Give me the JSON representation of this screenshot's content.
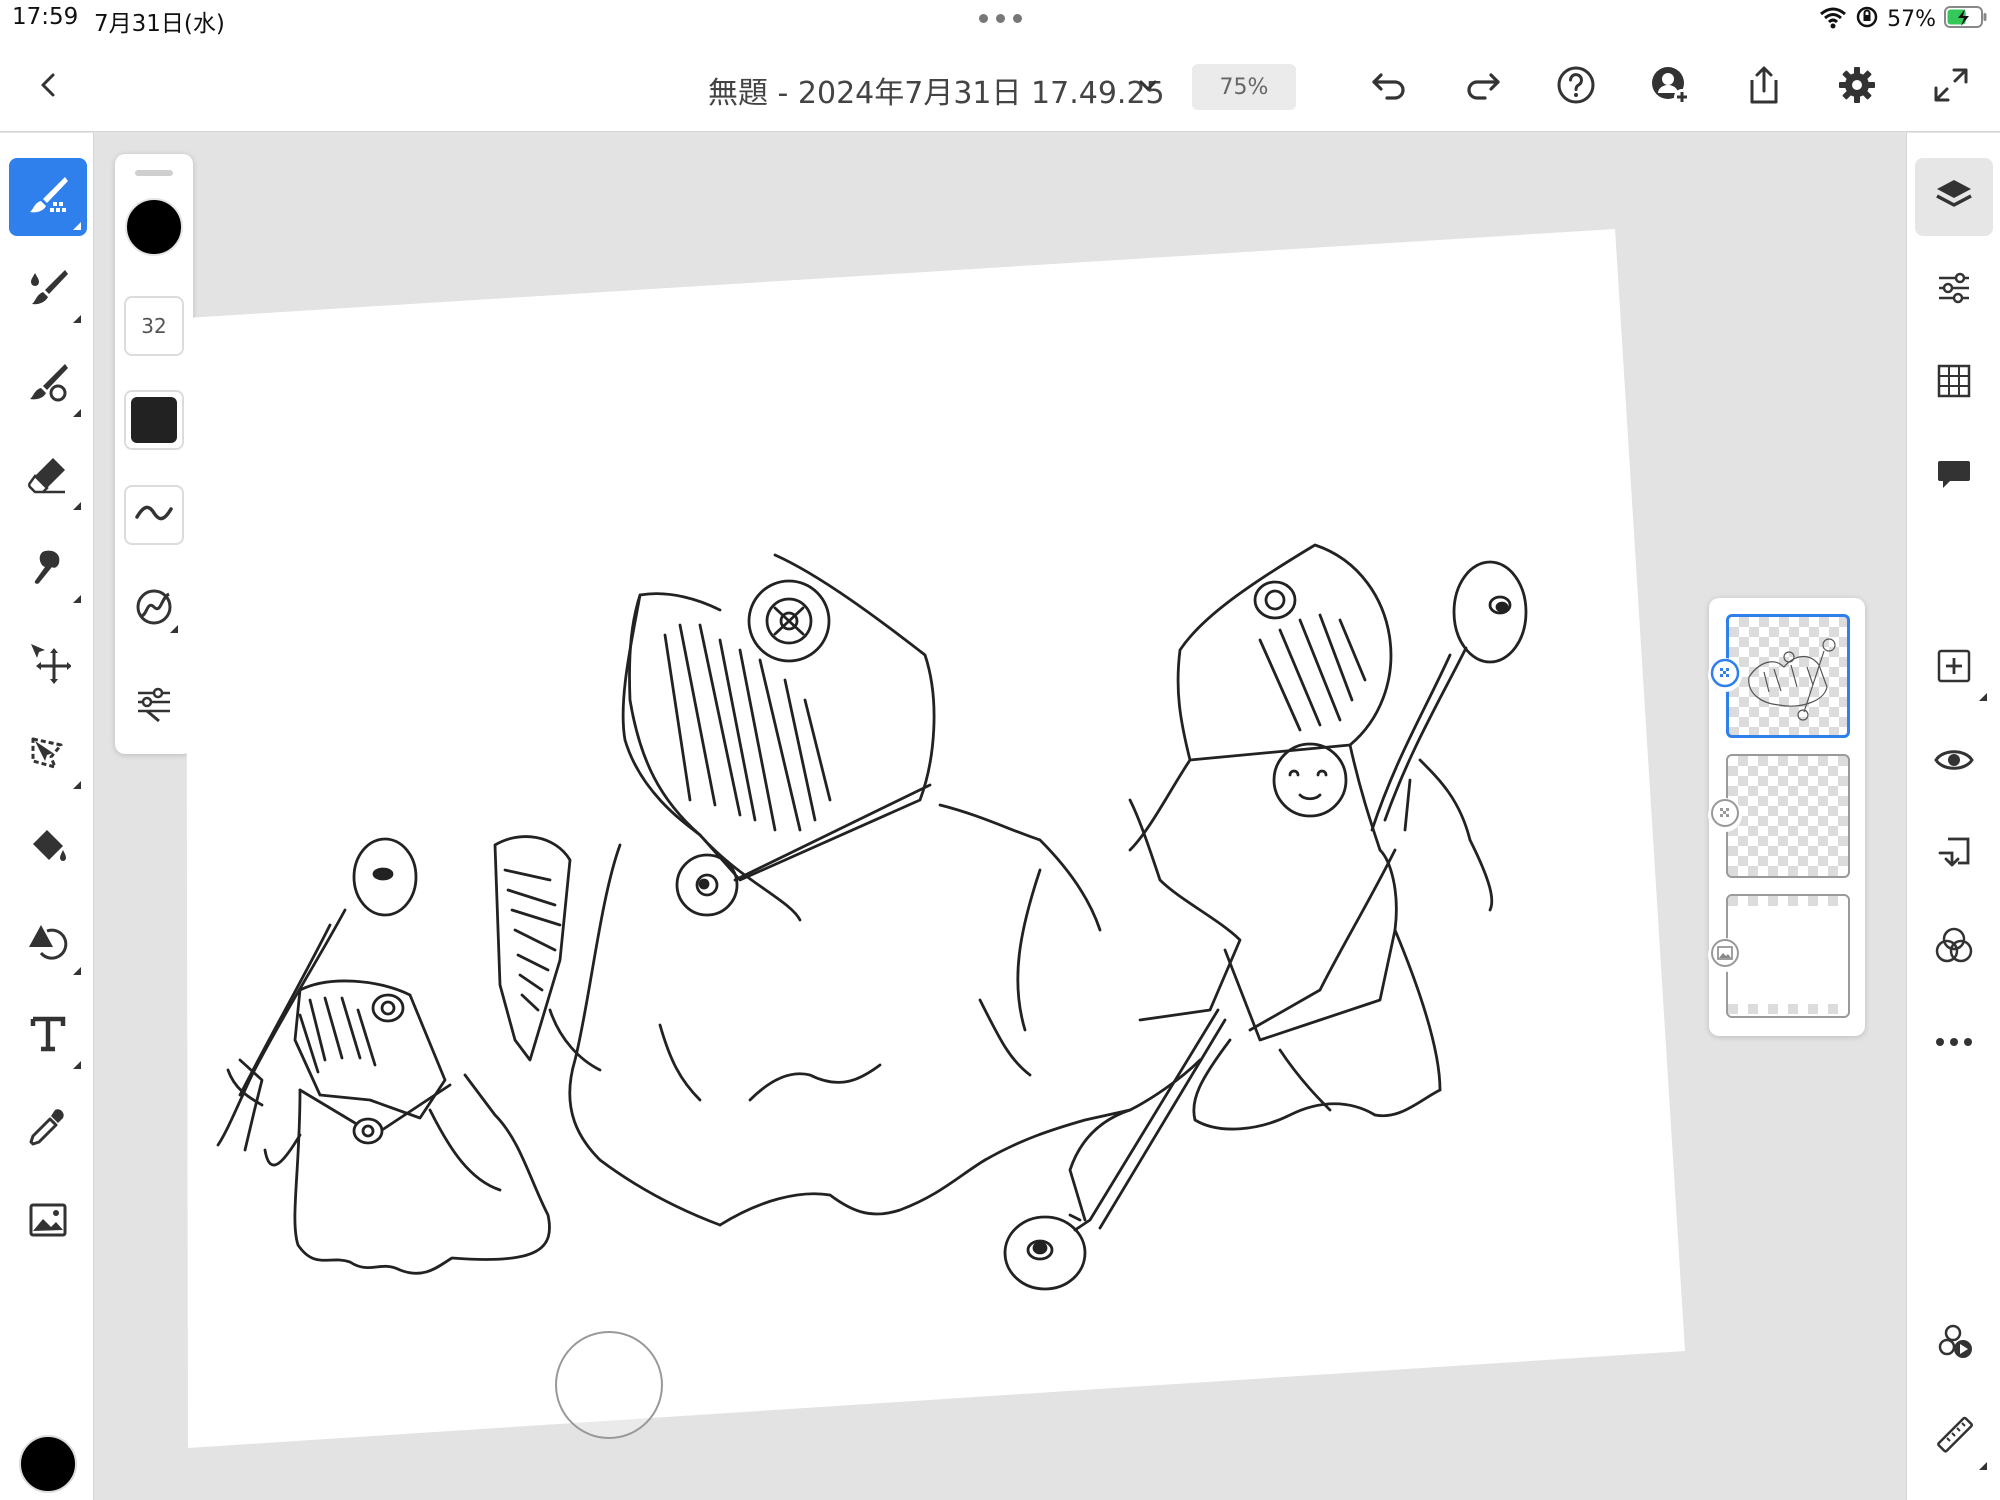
{
  "status_bar": {
    "time": "17:59",
    "date": "7月31日(水)",
    "battery_percent": "57%",
    "battery_level": 0.57,
    "battery_color": "#34c759"
  },
  "top_bar": {
    "document_title": "無題 - 2024年7月31日 17.49.25",
    "zoom_level": "75%"
  },
  "brush_panel": {
    "brush_size": "32",
    "brush_color": "#000000"
  },
  "left_toolbar": {
    "active_tool": "pixel-brush",
    "tools": [
      "pixel-brush",
      "live-brush",
      "vector-brush",
      "eraser",
      "smudge",
      "move-transform",
      "lasso-select",
      "fill",
      "undo-history",
      "text",
      "eyedropper",
      "place-image"
    ],
    "color_swatch": "#000000"
  },
  "layers": {
    "count": 3,
    "selected_index": 0,
    "items": [
      {
        "type": "pixel",
        "content": "drawing"
      },
      {
        "type": "pixel",
        "content": "empty"
      },
      {
        "type": "image",
        "content": "background"
      }
    ]
  },
  "right_toolbar": {
    "tools": [
      "layers",
      "adjustments",
      "grid",
      "comments",
      "add-layer",
      "visibility",
      "import-layer",
      "blend-mode",
      "more-options",
      "livestream",
      "ruler"
    ]
  },
  "colors": {
    "accent": "#2f80ed",
    "canvas_background": "#e3e3e3",
    "artboard": "#ffffff",
    "ink": "#222222"
  }
}
